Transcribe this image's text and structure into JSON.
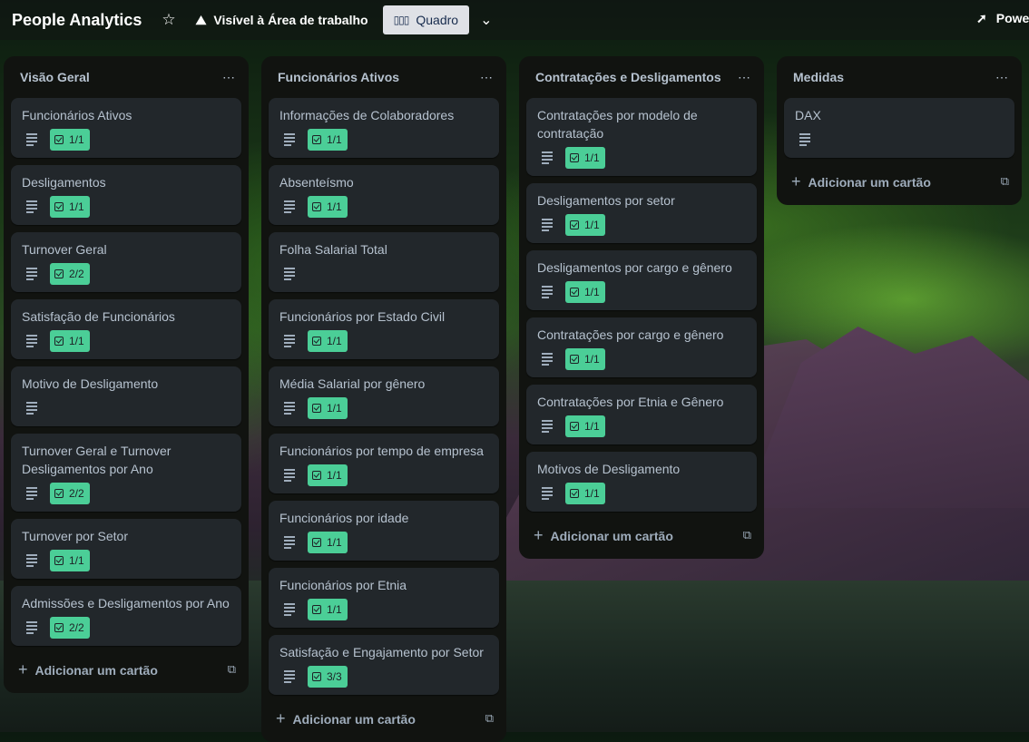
{
  "topbar": {
    "board_title": "People Analytics",
    "visibility": "Visível à Área de trabalho",
    "view": "Quadro",
    "power": "Power-Ups"
  },
  "add_card_label": "Adicionar um cartão",
  "lists": [
    {
      "title": "Visão Geral",
      "cards": [
        {
          "title": "Funcionários Ativos",
          "checklist": "1/1"
        },
        {
          "title": "Desligamentos",
          "checklist": "1/1"
        },
        {
          "title": "Turnover Geral",
          "checklist": "2/2"
        },
        {
          "title": "Satisfação de Funcionários",
          "checklist": "1/1"
        },
        {
          "title": "Motivo de Desligamento",
          "checklist": ""
        },
        {
          "title": "Turnover Geral e Turnover Desligamentos por Ano",
          "checklist": "2/2"
        },
        {
          "title": "Turnover por Setor",
          "checklist": "1/1"
        },
        {
          "title": "Admissões e Desligamentos por Ano",
          "checklist": "2/2"
        }
      ]
    },
    {
      "title": "Funcionários Ativos",
      "cards": [
        {
          "title": "Informações de Colaboradores",
          "checklist": "1/1"
        },
        {
          "title": "Absenteísmo",
          "checklist": "1/1"
        },
        {
          "title": "Folha Salarial Total",
          "checklist": ""
        },
        {
          "title": "Funcionários por Estado Civil",
          "checklist": "1/1"
        },
        {
          "title": "Média Salarial por gênero",
          "checklist": "1/1"
        },
        {
          "title": "Funcionários por tempo de empresa",
          "checklist": "1/1"
        },
        {
          "title": "Funcionários por idade",
          "checklist": "1/1"
        },
        {
          "title": "Funcionários por Etnia",
          "checklist": "1/1"
        },
        {
          "title": "Satisfação e Engajamento por Setor",
          "checklist": "3/3"
        }
      ]
    },
    {
      "title": "Contratações e Desligamentos",
      "cards": [
        {
          "title": "Contratações por modelo de contratação",
          "checklist": "1/1"
        },
        {
          "title": "Desligamentos por setor",
          "checklist": "1/1"
        },
        {
          "title": "Desligamentos por cargo e gênero",
          "checklist": "1/1"
        },
        {
          "title": "Contratações por cargo e gênero",
          "checklist": "1/1"
        },
        {
          "title": "Contratações por Etnia e Gênero",
          "checklist": "1/1"
        },
        {
          "title": "Motivos de Desligamento",
          "checklist": "1/1"
        }
      ]
    },
    {
      "title": "Medidas",
      "cards": [
        {
          "title": "DAX",
          "checklist": ""
        }
      ]
    }
  ]
}
